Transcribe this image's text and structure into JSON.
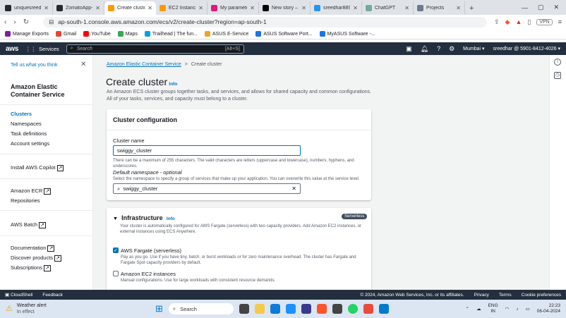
{
  "browser": {
    "tabs": [
      {
        "title": "uniquesreedhar/f",
        "color": "#24292f"
      },
      {
        "title": "ZomatoApp-Clon",
        "color": "#24292f"
      },
      {
        "title": "Create cluster",
        "color": "#ff9900",
        "active": true
      },
      {
        "title": "EC2 Instance Con",
        "color": "#ff9900"
      },
      {
        "title": "My parameters -",
        "color": "#e7157b"
      },
      {
        "title": "New story – Medi",
        "color": "#000000"
      },
      {
        "title": "sreedhar8897/swi",
        "color": "#2496ed"
      },
      {
        "title": "ChatGPT",
        "color": "#74aa9c"
      },
      {
        "title": "Projects",
        "color": "#6b7a8f"
      }
    ],
    "url": "ap-south-1.console.aws.amazon.com/ecs/v2/create-cluster?region=ap-south-1",
    "vpn_label": "VPN",
    "bookmarks": [
      {
        "label": "Manage Exports",
        "color": "#7b1fa2"
      },
      {
        "label": "Gmail",
        "color": "#ea4335"
      },
      {
        "label": "YouTube",
        "color": "#ff0000"
      },
      {
        "label": "Maps",
        "color": "#34a853"
      },
      {
        "label": "Trailhead | The fun...",
        "color": "#00a1e0"
      },
      {
        "label": "ASUS E-Service",
        "color": "#e8a82b"
      },
      {
        "label": "ASUS Software Port...",
        "color": "#1a73e8"
      },
      {
        "label": "MyASUS Software -...",
        "color": "#1a73e8"
      }
    ]
  },
  "aws_nav": {
    "logo": "aws",
    "services": "Services",
    "search_placeholder": "Search",
    "search_shortcut": "[Alt+S]",
    "region": "Mumbai ▾",
    "account": "sreedhar @ 5901-8412-4026 ▾"
  },
  "sidebar": {
    "tell_us": "Tell us what you think",
    "title": "Amazon Elastic Container Service",
    "items": [
      {
        "label": "Clusters",
        "active": true
      },
      {
        "label": "Namespaces"
      },
      {
        "label": "Task definitions"
      },
      {
        "label": "Account settings"
      }
    ],
    "install_copilot": "Install AWS Copilot",
    "ecr": "Amazon ECR",
    "repositories": "Repositories",
    "batch": "AWS Batch",
    "documentation": "Documentation",
    "discover": "Discover products",
    "subscriptions": "Subscriptions"
  },
  "main": {
    "breadcrumb_link": "Amazon Elastic Container Service",
    "breadcrumb_sep": ">",
    "breadcrumb_current": "Create cluster",
    "title": "Create cluster",
    "info": "Info",
    "description": "An Amazon ECS cluster groups together tasks, and services, and allows for shared capacity and common configurations. All of your tasks, services, and capacity must belong to a cluster.",
    "config": {
      "header": "Cluster configuration",
      "name_label": "Cluster name",
      "name_value": "swiggy_cluster",
      "name_hint": "There can be a maximum of 255 characters. The valid characters are letters (uppercase and lowercase), numbers, hyphens, and underscores.",
      "ns_label": "Default namespace - optional",
      "ns_hint": "Select the namespace to specify a group of services that make up your application. You can overwrite this value at the service level.",
      "ns_value": "swiggy_cluster"
    },
    "infra": {
      "header": "Infrastructure",
      "info": "Info",
      "badge": "Serverless",
      "description": "Your cluster is automatically configured for AWS Fargate (serverless) with two capacity providers. Add Amazon EC2 instances, or external instances using ECS Anywhere.",
      "fargate_label": "AWS Fargate (serverless)",
      "fargate_desc": "Pay as you go. Use if you have tiny, batch, or burst workloads or for zero maintenance overhead. The cluster has Fargate and Fargate Spot capacity providers by default.",
      "ec2_label": "Amazon EC2 instances",
      "ec2_desc": "Manual configurations. Use for large workloads with consistent resource demands."
    }
  },
  "footer": {
    "cloudshell": "CloudShell",
    "feedback": "Feedback",
    "copyright": "© 2024, Amazon Web Services, Inc. or its affiliates.",
    "privacy": "Privacy",
    "terms": "Terms",
    "cookies": "Cookie preferences"
  },
  "taskbar": {
    "weather_title": "Weather alert",
    "weather_sub": "In effect",
    "search": "Search",
    "lang1": "ENG",
    "lang2": "IN",
    "time": "22:23",
    "date": "06-04-2024"
  }
}
